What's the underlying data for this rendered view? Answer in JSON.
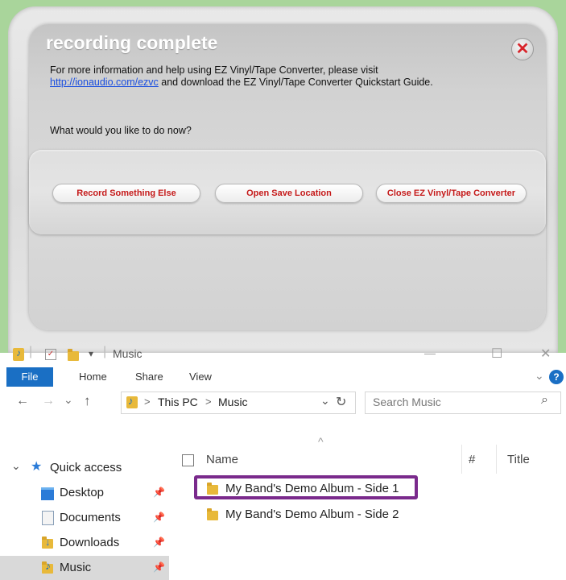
{
  "dialog": {
    "title": "recording complete",
    "info_prefix": "For more information and help using EZ Vinyl/Tape Converter, please visit",
    "info_link": "http://ionaudio.com/ezvc",
    "info_suffix": " and download the EZ Vinyl/Tape Converter Quickstart Guide.",
    "prompt": "What would you like to do now?",
    "close_glyph": "✕",
    "buttons": {
      "record": "Record Something Else",
      "open": "Open Save Location",
      "close_app": "Close EZ Vinyl/Tape Converter"
    },
    "colors": {
      "button_text": "#c51a1a",
      "close_x": "#d8242a",
      "page_bg": "#a9d59b"
    }
  },
  "explorer": {
    "window_title": "Music",
    "quick_access_dropdown": "▾",
    "caption": {
      "minimize": "—",
      "maximize": "☐",
      "close": "✕"
    },
    "tabs": {
      "file": "File",
      "home": "Home",
      "share": "Share",
      "view": "View"
    },
    "ribbon_expand": "⌄",
    "help": "?",
    "nav": {
      "back": "←",
      "forward": "→",
      "recent": "⌄",
      "up": "↑"
    },
    "breadcrumb": {
      "this_pc": "This PC",
      "sep": ">",
      "music": "Music"
    },
    "refresh": "↻",
    "addr_dropdown": "⌄",
    "search_placeholder": "Search Music",
    "search_glyph": "⌕",
    "sort_glyph": "^",
    "columns": {
      "name": "Name",
      "number": "#",
      "title": "Title"
    },
    "files": [
      {
        "name": "My Band's Demo Album - Side 1"
      },
      {
        "name": "My Band's Demo Album - Side 2"
      }
    ],
    "sidebar": {
      "quick_access": "Quick access",
      "expand": "⌄",
      "pin": "📌",
      "items": [
        {
          "label": "Desktop"
        },
        {
          "label": "Documents"
        },
        {
          "label": "Downloads"
        },
        {
          "label": "Music"
        }
      ]
    },
    "colors": {
      "file_tab": "#1a6fc4",
      "highlight_border": "#7a2a8c",
      "selected_row": "#d9d9d9"
    }
  }
}
